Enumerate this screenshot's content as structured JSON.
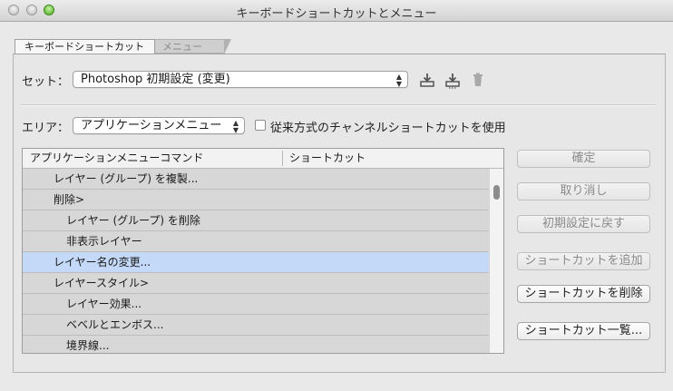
{
  "window": {
    "title": "キーボードショートカットとメニュー"
  },
  "tabs": [
    {
      "label": "キーボードショートカット",
      "active": true
    },
    {
      "label": "メニュー",
      "active": false
    }
  ],
  "set": {
    "label": "セット：",
    "value": "Photoshop 初期設定 (変更)"
  },
  "area": {
    "label": "エリア：",
    "value": "アプリケーションメニュー",
    "legacy_checkbox_label": "従来方式のチャンネルショートカットを使用",
    "legacy_checked": false
  },
  "table": {
    "col_command": "アプリケーションメニューコマンド",
    "col_shortcut": "ショートカット",
    "rows": [
      {
        "command": "レイヤー (グループ) を複製...",
        "shortcut": ""
      },
      {
        "command": "削除>",
        "shortcut": ""
      },
      {
        "command": "レイヤー (グループ) を削除",
        "shortcut": ""
      },
      {
        "command": "非表示レイヤー",
        "shortcut": ""
      },
      {
        "command": "レイヤー名の変更...",
        "shortcut": ""
      },
      {
        "command": "レイヤースタイル>",
        "shortcut": ""
      },
      {
        "command": "レイヤー効果...",
        "shortcut": ""
      },
      {
        "command": "ベベルとエンボス...",
        "shortcut": ""
      },
      {
        "command": "境界線...",
        "shortcut": ""
      }
    ],
    "selected_index": 4
  },
  "buttons": {
    "ok": "確定",
    "undo": "取り消し",
    "defaults": "初期設定に戻す",
    "add_shortcut": "ショートカットを追加",
    "delete_shortcut": "ショートカットを削除",
    "summarize": "ショートカット一覧..."
  },
  "icons": {
    "save_set": "save-set-icon",
    "save_set_as": "save-set-as-icon",
    "delete_set": "trash-icon"
  }
}
